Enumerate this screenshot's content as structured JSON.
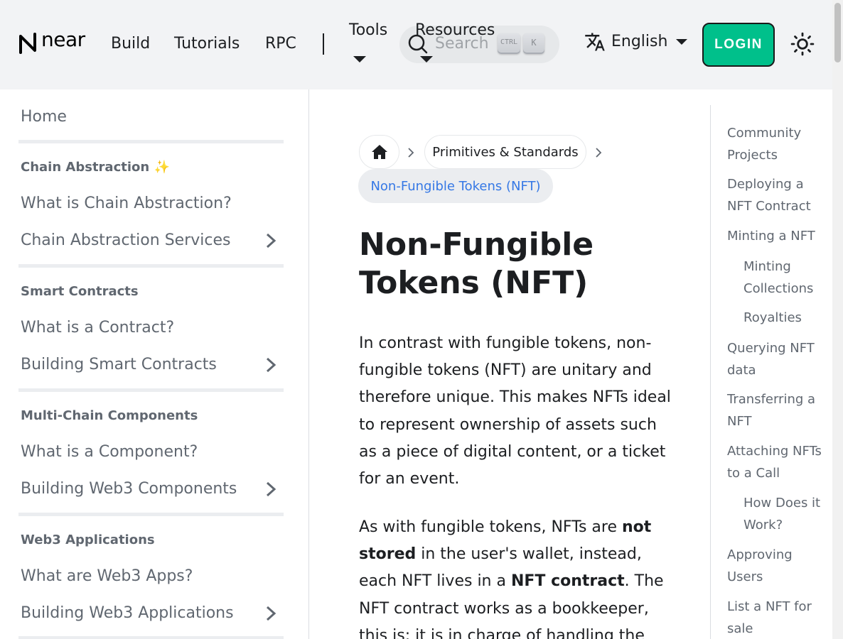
{
  "navbar": {
    "logo_text": "near",
    "links": {
      "build": "Build",
      "tutorials": "Tutorials",
      "rpc": "RPC",
      "tools": "Tools",
      "resources": "Resources"
    },
    "search": {
      "placeholder": "Search",
      "kbd_ctrl": "CTRL",
      "kbd_k": "K"
    },
    "language": "English",
    "login_label": "LOGIN"
  },
  "sidebar": {
    "home": "Home",
    "sections": [
      {
        "category": "Chain Abstraction ✨",
        "items": [
          "What is Chain Abstraction?",
          "Chain Abstraction Services"
        ]
      },
      {
        "category": "Smart Contracts",
        "items": [
          "What is a Contract?",
          "Building Smart Contracts"
        ]
      },
      {
        "category": "Multi-Chain Components",
        "items": [
          "What is a Component?",
          "Building Web3 Components"
        ]
      },
      {
        "category": "Web3 Applications",
        "items": [
          "What are Web3 Apps?",
          "Building Web3 Applications"
        ]
      }
    ]
  },
  "breadcrumbs": {
    "second": "Primitives & Standards",
    "current": "Non-Fungible Tokens (NFT)"
  },
  "article": {
    "title": "Non-Fungible Tokens (NFT)",
    "p1": "In contrast with fungible tokens, non-fungible tokens (NFT) are unitary and therefore unique. This makes NFTs ideal to represent ownership of assets such as a piece of digital content, or a ticket for an event.",
    "p2_a": "As with fungible tokens, NFTs are ",
    "p2_b": "not stored",
    "p2_c": " in the user's wallet, instead, each NFT lives in a ",
    "p2_d": "NFT contract",
    "p2_e": ". The NFT contract works as a bookkeeper, this is: it is in charge of handling the"
  },
  "toc": [
    "Community Projects",
    "Deploying a NFT Contract",
    "Minting a NFT",
    "Minting Collections",
    "Royalties",
    "Querying NFT data",
    "Transferring a NFT",
    "Attaching NFTs to a Call",
    "How Does it Work?",
    "Approving Users",
    "List a NFT for sale"
  ],
  "colors": {
    "accent": "#00c08b",
    "link": "#3578e5",
    "navbar_bg": "#f2f3f5"
  },
  "icons": [
    "near-logo-icon",
    "caret-down-icon",
    "search-icon",
    "translate-icon",
    "sun-icon",
    "home-icon",
    "chevron-right-icon"
  ]
}
